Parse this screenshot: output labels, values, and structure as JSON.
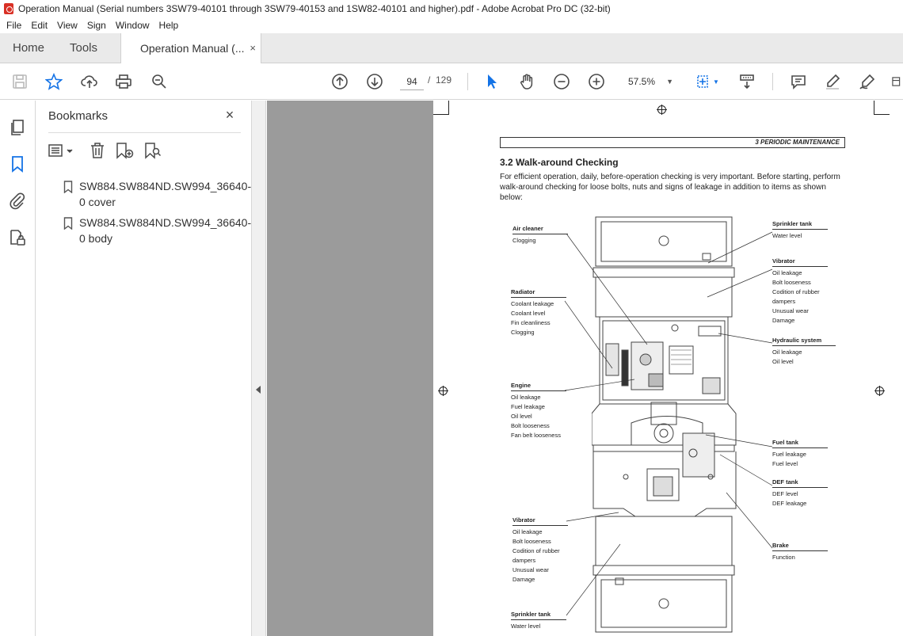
{
  "window": {
    "title": "Operation Manual (Serial numbers 3SW79-40101 through 3SW79-40153 and 1SW82-40101 and higher).pdf - Adobe Acrobat Pro DC (32-bit)"
  },
  "menu": [
    "File",
    "Edit",
    "View",
    "Sign",
    "Window",
    "Help"
  ],
  "tabs": {
    "home": "Home",
    "tools": "Tools",
    "document": "Operation Manual (...",
    "close": "×"
  },
  "toolbar": {
    "current_page": "94",
    "separator": "/",
    "total_pages": "129",
    "zoom": "57.5%",
    "accent": "#1473e6"
  },
  "bookmarks": {
    "title": "Bookmarks",
    "close": "×",
    "items": [
      {
        "label": "SW884.SW884ND.SW994_36640-0 cover"
      },
      {
        "label": "SW884.SW884ND.SW994_36640-0 body"
      }
    ]
  },
  "document_page": {
    "running_head": "3   PERIODIC MAINTENANCE",
    "section_title": "3.2  Walk-around Checking",
    "intro": "For efficient operation, daily, before-operation checking is very important. Before starting, perform walk-around checking for loose bolts, nuts and signs of leakage in addition to items as shown below:",
    "callouts": {
      "air_cleaner": {
        "title": "Air cleaner",
        "items": [
          "Clogging"
        ]
      },
      "radiator": {
        "title": "Radiator",
        "items": [
          "Coolant leakage",
          "Coolant level",
          "Fin cleanliness",
          "Clogging"
        ]
      },
      "engine": {
        "title": "Engine",
        "items": [
          "Oil leakage",
          "Fuel leakage",
          "Oil level",
          "Bolt looseness",
          "Fan belt looseness"
        ]
      },
      "vibrator_rear": {
        "title": "Vibrator",
        "items": [
          "Oil leakage",
          "Bolt looseness",
          "Codition of rubber",
          "dampers",
          "Unusual wear",
          "Damage"
        ]
      },
      "sprinkler_rear": {
        "title": "Sprinkler tank",
        "items": [
          "Water level"
        ]
      },
      "sprinkler_front": {
        "title": "Sprinkler tank",
        "items": [
          "Water level"
        ]
      },
      "vibrator_front": {
        "title": "Vibrator",
        "items": [
          "Oil leakage",
          "Bolt looseness",
          "Codition of rubber",
          "dampers",
          "Unusual wear",
          "Damage"
        ]
      },
      "hydraulic": {
        "title": "Hydraulic system",
        "items": [
          "Oil leakage",
          "Oil level"
        ]
      },
      "fuel_tank": {
        "title": "Fuel tank",
        "items": [
          "Fuel leakage",
          "Fuel level"
        ]
      },
      "def_tank": {
        "title": "DEF tank",
        "items": [
          "DEF level",
          "DEF leakage"
        ]
      },
      "brake": {
        "title": "Brake",
        "items": [
          "Function"
        ]
      }
    }
  }
}
